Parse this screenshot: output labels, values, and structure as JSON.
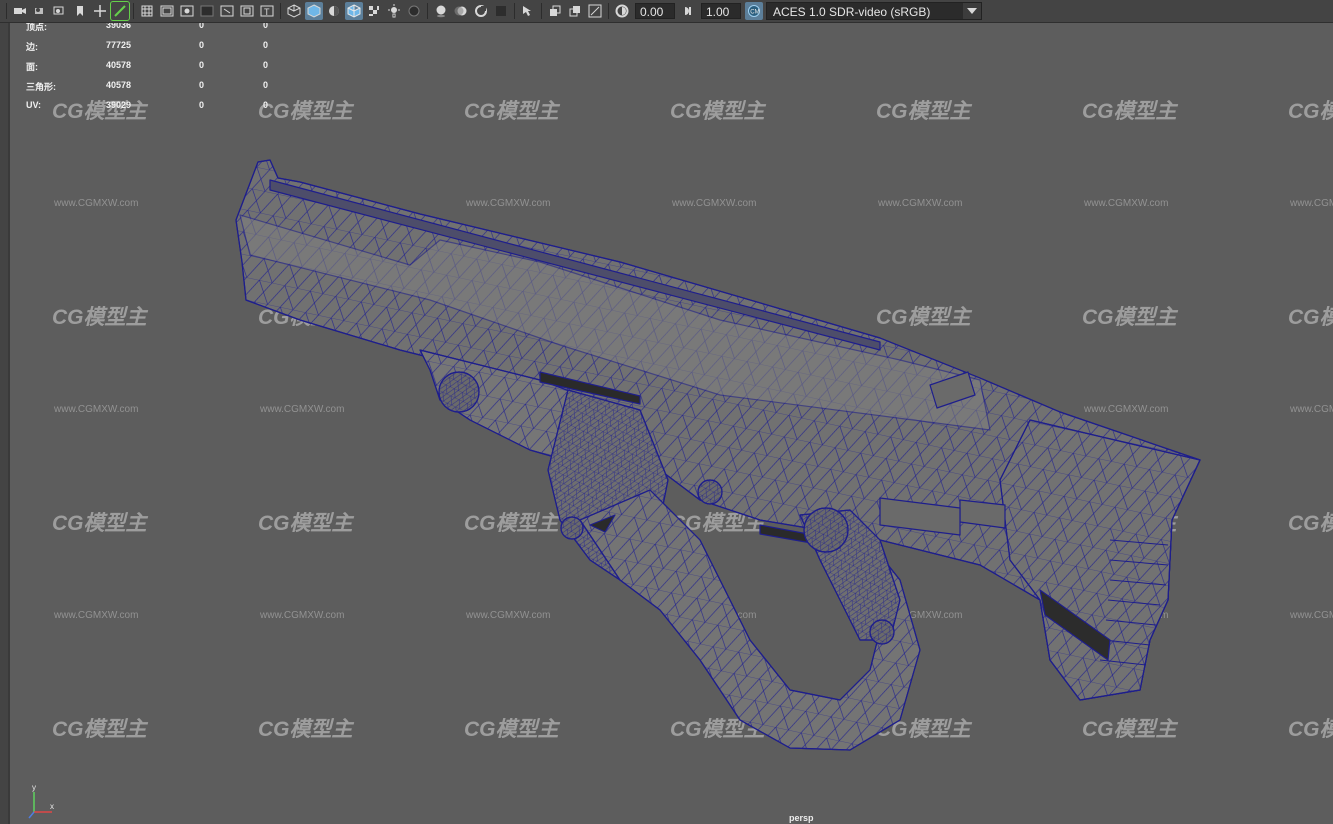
{
  "toolbar": {
    "exposure_value": "0.00",
    "gamma_value": "1.00",
    "color_space": "ACES 1.0 SDR-video (sRGB)"
  },
  "hud": {
    "rows": [
      {
        "label": "顶点:",
        "v1": "39036",
        "v2": "0",
        "v3": "0"
      },
      {
        "label": "边:",
        "v1": "77725",
        "v2": "0",
        "v3": "0"
      },
      {
        "label": "面:",
        "v1": "40578",
        "v2": "0",
        "v3": "0"
      },
      {
        "label": "三角形:",
        "v1": "40578",
        "v2": "0",
        "v3": "0"
      },
      {
        "label": "UV:",
        "v1": "39029",
        "v2": "0",
        "v3": "0"
      }
    ]
  },
  "watermark": {
    "logo": "CG模型主",
    "url": "www.CGMXW.com"
  },
  "viewport": {
    "camera": "persp"
  },
  "axis": {
    "y": "y",
    "x": "x"
  },
  "colors": {
    "background": "#5d5d5d",
    "mesh_fill": "#6e6e6e",
    "wireframe": "#1e1e8c"
  }
}
